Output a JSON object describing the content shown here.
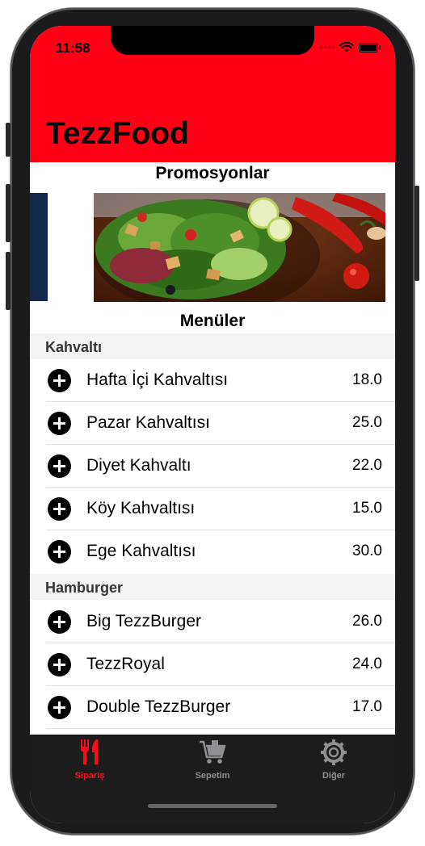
{
  "status_bar": {
    "time": "11:58"
  },
  "header": {
    "title": "TezzFood",
    "color": "#ff0015"
  },
  "promotions": {
    "title": "Promosyonlar"
  },
  "menus": {
    "title": "Menüler"
  },
  "categories": [
    {
      "name": "Kahvaltı",
      "items": [
        {
          "name": "Hafta İçi Kahvaltısı",
          "price": "18.0"
        },
        {
          "name": "Pazar Kahvaltısı",
          "price": "25.0"
        },
        {
          "name": "Diyet Kahvaltı",
          "price": "22.0"
        },
        {
          "name": "Köy Kahvaltısı",
          "price": "15.0"
        },
        {
          "name": "Ege Kahvaltısı",
          "price": "30.0"
        }
      ]
    },
    {
      "name": "Hamburger",
      "items": [
        {
          "name": "Big TezzBurger",
          "price": "26.0"
        },
        {
          "name": "TezzRoyal",
          "price": "24.0"
        },
        {
          "name": "Double TezzBurger",
          "price": "17.0"
        }
      ]
    }
  ],
  "tabbar": {
    "tabs": [
      {
        "label": "Sipariş",
        "icon": "fork-knife-icon",
        "active": true,
        "color": "#ff0a1a"
      },
      {
        "label": "Sepetim",
        "icon": "cart-icon",
        "active": false,
        "color": "#8e8e93"
      },
      {
        "label": "Diğer",
        "icon": "gear-icon",
        "active": false,
        "color": "#8e8e93"
      }
    ]
  }
}
